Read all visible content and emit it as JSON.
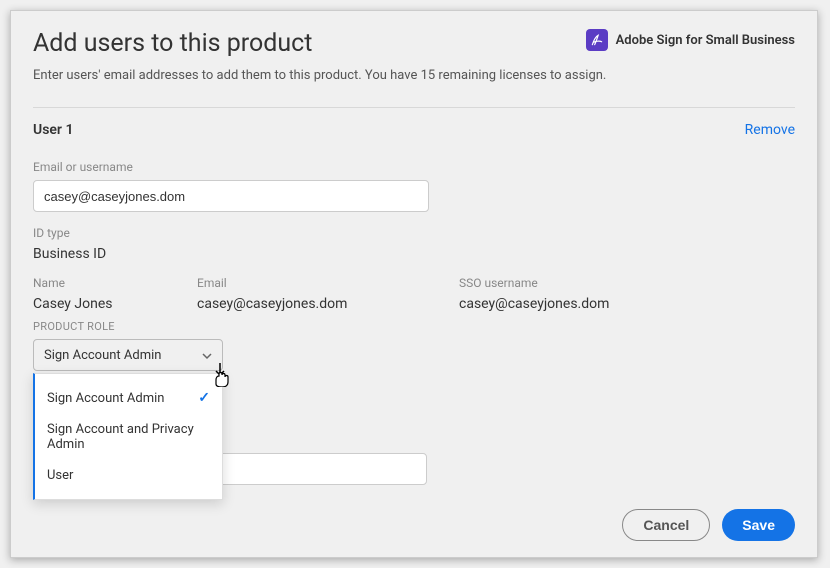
{
  "header": {
    "title": "Add users to this product",
    "product_name": "Adobe Sign for Small Business",
    "subtitle": "Enter users' email addresses to add them to this product. You have 15 remaining licenses to assign."
  },
  "user1": {
    "section_label": "User 1",
    "remove_label": "Remove",
    "email_label": "Email or username",
    "email_value": "casey@caseyjones.dom",
    "id_type_label": "ID type",
    "id_type_value": "Business ID",
    "name_label": "Name",
    "name_value": "Casey Jones",
    "email_col_label": "Email",
    "email_col_value": "casey@caseyjones.dom",
    "sso_label": "SSO username",
    "sso_value": "casey@caseyjones.dom",
    "role_label": "PRODUCT ROLE",
    "role_selected": "Sign Account Admin",
    "role_options": {
      "opt1": "Sign Account Admin",
      "opt2": "Sign Account and Privacy Admin",
      "opt3": "User"
    }
  },
  "footer": {
    "cancel": "Cancel",
    "save": "Save"
  }
}
